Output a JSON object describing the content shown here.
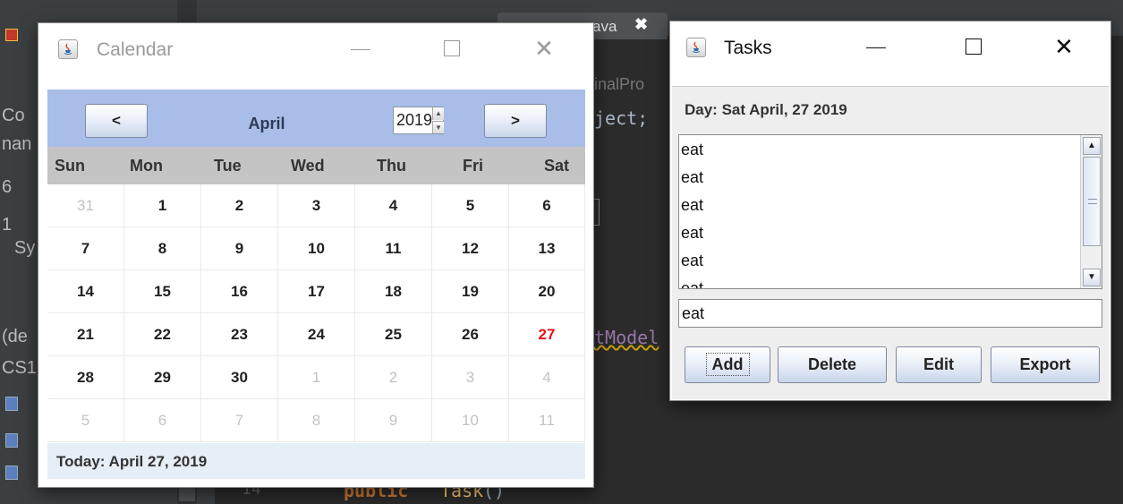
{
  "ide": {
    "tab_label": "ava",
    "tab_close": "✖",
    "path_fragment": "inalPro",
    "code_fragment": "ject;",
    "model_fragment": "tModel",
    "line_number": "14",
    "keyword": "public",
    "constructor": "Task",
    "parens": "()",
    "left_fragments": [
      "Co",
      "nan",
      "6",
      "1",
      "Sy",
      "(de",
      "CS1"
    ]
  },
  "calendar": {
    "window_title": "Calendar",
    "prev_label": "<",
    "next_label": ">",
    "month": "April",
    "year": "2019",
    "days_of_week": [
      "Sun",
      "Mon",
      "Tue",
      "Wed",
      "Thu",
      "Fri",
      "Sat"
    ],
    "weeks": [
      [
        {
          "d": "31",
          "other": true
        },
        {
          "d": "1"
        },
        {
          "d": "2"
        },
        {
          "d": "3"
        },
        {
          "d": "4"
        },
        {
          "d": "5"
        },
        {
          "d": "6"
        }
      ],
      [
        {
          "d": "7"
        },
        {
          "d": "8"
        },
        {
          "d": "9"
        },
        {
          "d": "10"
        },
        {
          "d": "11"
        },
        {
          "d": "12"
        },
        {
          "d": "13"
        }
      ],
      [
        {
          "d": "14"
        },
        {
          "d": "15"
        },
        {
          "d": "16"
        },
        {
          "d": "17"
        },
        {
          "d": "18"
        },
        {
          "d": "19"
        },
        {
          "d": "20"
        }
      ],
      [
        {
          "d": "21"
        },
        {
          "d": "22"
        },
        {
          "d": "23"
        },
        {
          "d": "24"
        },
        {
          "d": "25"
        },
        {
          "d": "26"
        },
        {
          "d": "27",
          "today": true
        }
      ],
      [
        {
          "d": "28"
        },
        {
          "d": "29"
        },
        {
          "d": "30"
        },
        {
          "d": "1",
          "other": true
        },
        {
          "d": "2",
          "other": true
        },
        {
          "d": "3",
          "other": true
        },
        {
          "d": "4",
          "other": true
        }
      ],
      [
        {
          "d": "5",
          "other": true
        },
        {
          "d": "6",
          "other": true
        },
        {
          "d": "7",
          "other": true
        },
        {
          "d": "8",
          "other": true
        },
        {
          "d": "9",
          "other": true
        },
        {
          "d": "10",
          "other": true
        },
        {
          "d": "11",
          "other": true
        }
      ]
    ],
    "today_text": "Today: April 27, 2019",
    "colors": {
      "header_bg": "#a8bee8",
      "today_red": "#e8111a"
    }
  },
  "tasks": {
    "window_title": "Tasks",
    "day_label": "Day: Sat April, 27 2019",
    "items": [
      "eat",
      "eat",
      "eat",
      "eat",
      "eat",
      "eat"
    ],
    "input_value": "eat",
    "buttons": {
      "add": "Add",
      "delete": "Delete",
      "edit": "Edit",
      "export": "Export"
    }
  },
  "window_controls": {
    "minimize": "minimize-icon",
    "maximize": "maximize-icon",
    "close": "close-icon",
    "close_glyph": "✕"
  }
}
